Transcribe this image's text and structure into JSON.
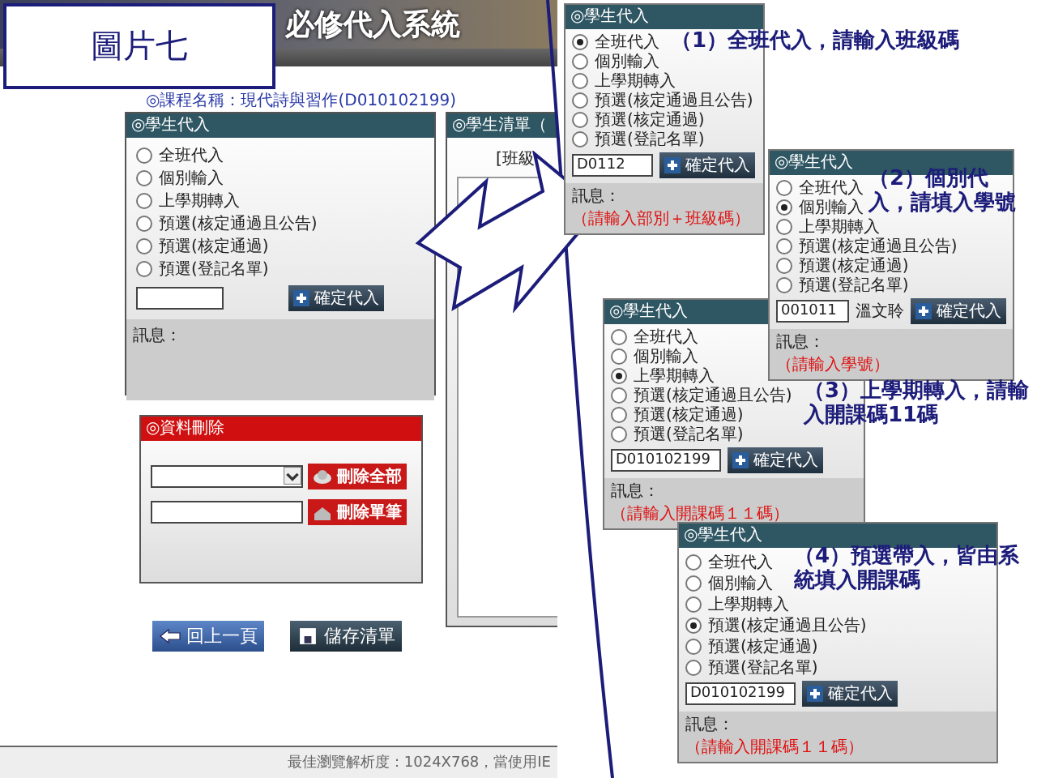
{
  "slide_label": "圖片七",
  "site": {
    "title": "必修代入系統",
    "course": "◎課程名稱：現代詩與習作(D010102199)",
    "entry_panel": {
      "title": "◎學生代入",
      "options": [
        {
          "label": "全班代入",
          "selected": false
        },
        {
          "label": "個別輸入",
          "selected": false
        },
        {
          "label": "上學期轉入",
          "selected": false
        },
        {
          "label": "預選(核定通過且公告)",
          "selected": false
        },
        {
          "label": "預選(核定通過)",
          "selected": false
        },
        {
          "label": "預選(登記名單)",
          "selected": false
        }
      ],
      "button": "確定代入",
      "message_label": "訊息："
    },
    "list_panel": {
      "title": "◎學生清單（",
      "class_label": "[班級"
    },
    "delete_panel": {
      "title": "◎資料刪除",
      "buttons": [
        "刪除全部",
        "刪除單筆"
      ]
    },
    "nav_buttons": [
      "回上一頁",
      "儲存清單"
    ],
    "footer": "最佳瀏覽解析度：1024X768，當使用IE"
  },
  "steps": [
    {
      "caption": "（1）全班代入，請輸入班級碼",
      "title": "◎學生代入",
      "options": [
        {
          "label": "全班代入",
          "selected": true
        },
        {
          "label": "個別輸入",
          "selected": false
        },
        {
          "label": "上學期轉入",
          "selected": false
        },
        {
          "label": "預選(核定通過且公告)",
          "selected": false
        },
        {
          "label": "預選(核定通過)",
          "selected": false
        },
        {
          "label": "預選(登記名單)",
          "selected": false
        }
      ],
      "value": "D0112",
      "button": "確定代入",
      "message_label": "訊息：",
      "message": "（請輸入部別＋班級碼）"
    },
    {
      "caption": "（2）個別代入，請填入學號",
      "title": "◎學生代入",
      "options": [
        {
          "label": "全班代入",
          "selected": false
        },
        {
          "label": "個別輸入",
          "selected": true
        },
        {
          "label": "上學期轉入",
          "selected": false
        },
        {
          "label": "預選(核定通過且公告)",
          "selected": false
        },
        {
          "label": "預選(核定通過)",
          "selected": false
        },
        {
          "label": "預選(登記名單)",
          "selected": false
        }
      ],
      "value": "001011",
      "student_name": "溫文聆",
      "button": "確定代入",
      "message_label": "訊息：",
      "message": "（請輸入學號）"
    },
    {
      "caption": "（3）上學期轉入，請輸入開課碼11碼",
      "title": "◎學生代入",
      "options": [
        {
          "label": "全班代入",
          "selected": false
        },
        {
          "label": "個別輸入",
          "selected": false
        },
        {
          "label": "上學期轉入",
          "selected": true
        },
        {
          "label": "預選(核定通過且公告)",
          "selected": false
        },
        {
          "label": "預選(核定通過)",
          "selected": false
        },
        {
          "label": "預選(登記名單)",
          "selected": false
        }
      ],
      "value": "D010102199",
      "button": "確定代入",
      "message_label": "訊息：",
      "message": "（請輸入開課碼１１碼）"
    },
    {
      "caption": "（4）預選帶入，皆由系統填入開課碼",
      "title": "◎學生代入",
      "options": [
        {
          "label": "全班代入",
          "selected": false
        },
        {
          "label": "個別輸入",
          "selected": false
        },
        {
          "label": "上學期轉入",
          "selected": false
        },
        {
          "label": "預選(核定通過且公告)",
          "selected": true
        },
        {
          "label": "預選(核定通過)",
          "selected": false
        },
        {
          "label": "預選(登記名單)",
          "selected": false
        }
      ],
      "value": "D010102199",
      "button": "確定代入",
      "message_label": "訊息：",
      "message": "（請輸入開課碼１１碼）"
    }
  ]
}
